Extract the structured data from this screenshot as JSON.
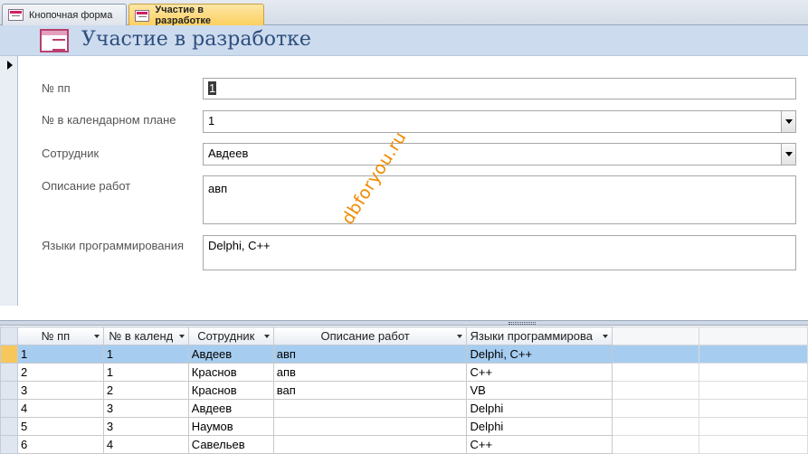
{
  "tabs": [
    {
      "label": "Кнопочная форма",
      "active": false
    },
    {
      "label": "Участие в разработке",
      "active": true
    }
  ],
  "form": {
    "title": "Участие в разработке",
    "fields": {
      "num_label": "№ пп",
      "num_value": "1",
      "plan_label": "№ в календарном плане",
      "plan_value": "1",
      "employee_label": "Сотрудник",
      "employee_value": "Авдеев",
      "desc_label": "Описание работ",
      "desc_value": "авп",
      "lang_label": "Языки программирования",
      "lang_value": "Delphi, C++"
    }
  },
  "watermark": "dbforyou.ru",
  "datasheet": {
    "columns": [
      "№ пп",
      "№ в календ",
      "Сотрудник",
      "Описание работ",
      "Языки программирова"
    ],
    "rows": [
      {
        "num": "1",
        "plan": "1",
        "employee": "Авдеев",
        "desc": "авп",
        "lang": "Delphi, C++"
      },
      {
        "num": "2",
        "plan": "1",
        "employee": "Краснов",
        "desc": "апв",
        "lang": "C++"
      },
      {
        "num": "3",
        "plan": "2",
        "employee": "Краснов",
        "desc": "вап",
        "lang": "VB"
      },
      {
        "num": "4",
        "plan": "3",
        "employee": "Авдеев",
        "desc": "",
        "lang": "Delphi"
      },
      {
        "num": "5",
        "plan": "3",
        "employee": "Наумов",
        "desc": "",
        "lang": "Delphi"
      },
      {
        "num": "6",
        "plan": "4",
        "employee": "Савельев",
        "desc": "",
        "lang": "C++"
      }
    ]
  },
  "colors": {
    "header_bg": "#cddbee",
    "title_color": "#2d4f7f",
    "active_tab": "#fbcf5c",
    "current_row": "#a6cdf0",
    "watermark": "#f08a00"
  }
}
